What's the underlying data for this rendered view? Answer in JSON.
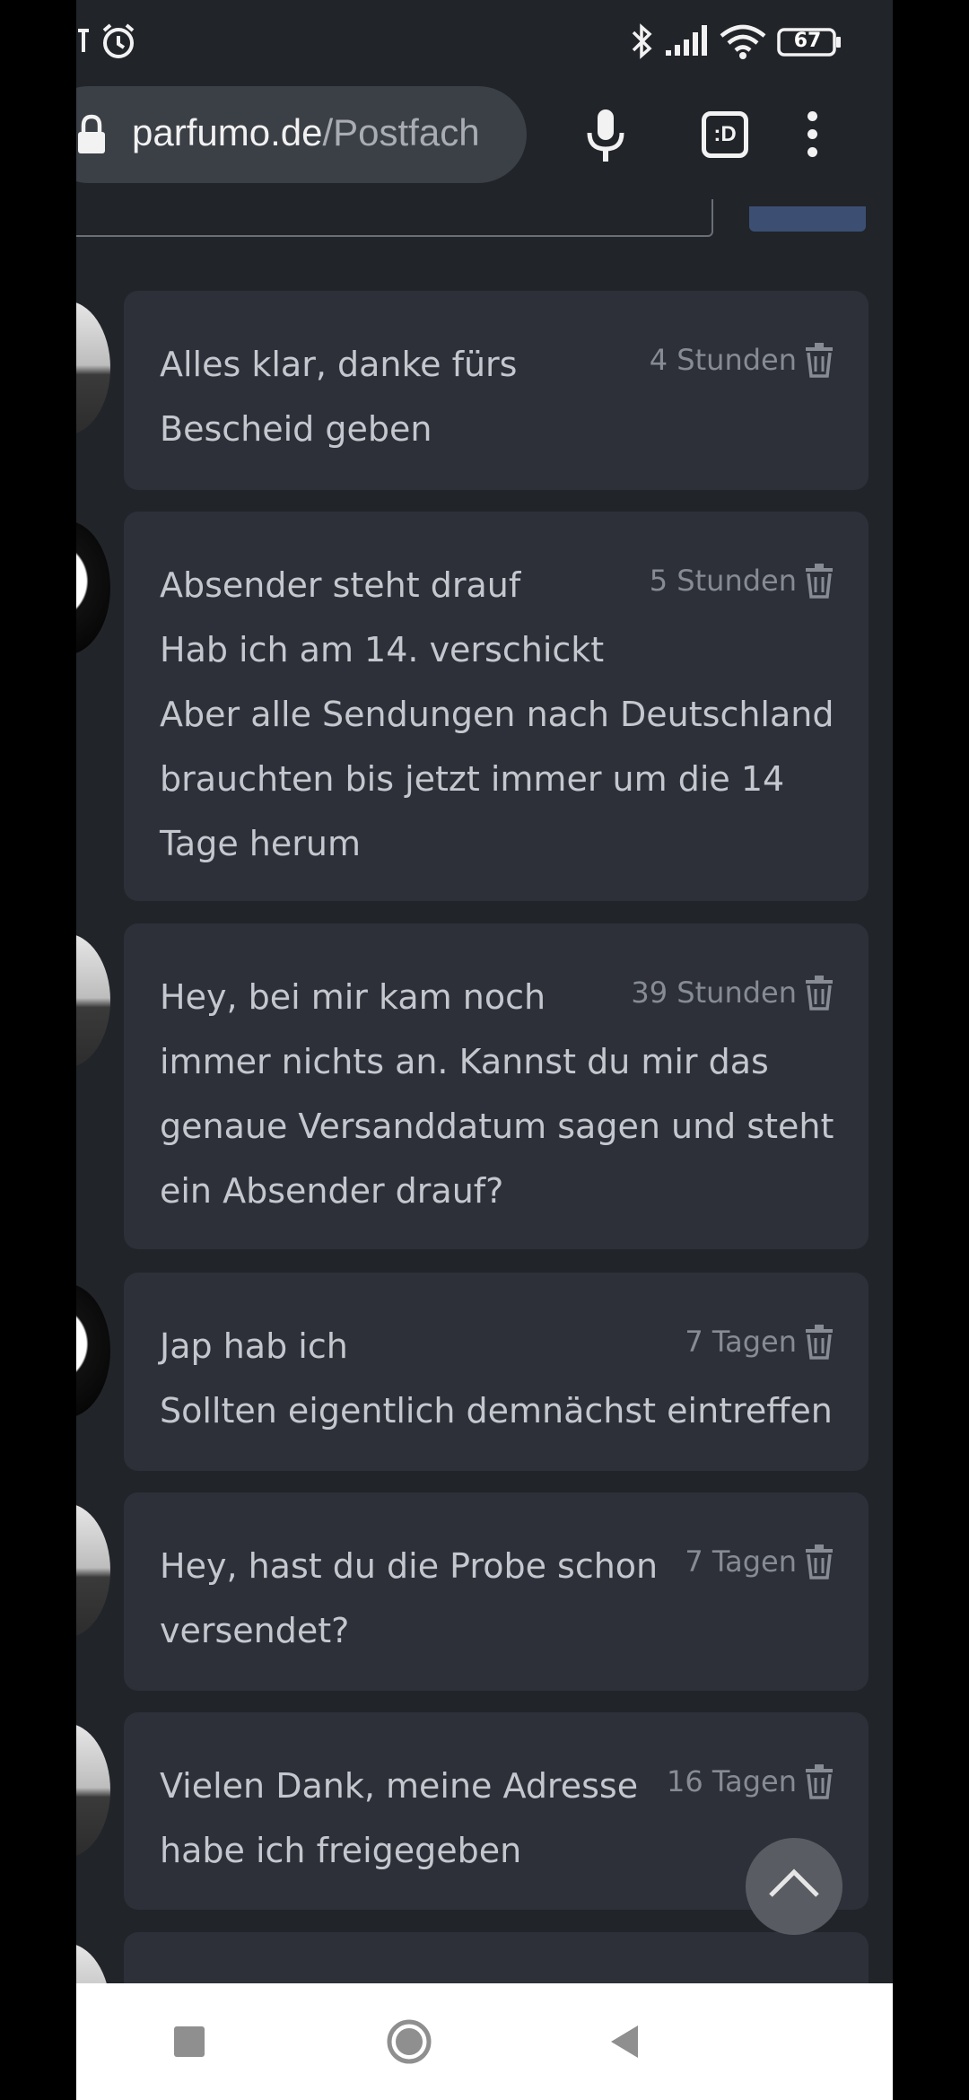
{
  "status_bar": {
    "battery": "67",
    "icons": [
      "alarm-icon",
      "bluetooth-icon",
      "signal-icon",
      "wifi-icon",
      "battery-icon"
    ]
  },
  "browser": {
    "url_host": "parfumo.de",
    "url_path": "/Postfach",
    "tab_icon_label": ":D",
    "icons": [
      "lock-icon",
      "microphone-icon",
      "tab-switcher-icon",
      "more-menu-icon"
    ]
  },
  "messages": [
    {
      "lines": [
        "Alles klar, danke fürs",
        "Bescheid geben"
      ],
      "time": "4 Stunden",
      "avatar": "grey"
    },
    {
      "lines": [
        "Absender steht drauf",
        "Hab ich am 14. verschickt",
        "Aber alle Sendungen nach Deutschland",
        "brauchten bis jetzt immer um die 14",
        "Tage herum"
      ],
      "time": "5 Stunden",
      "avatar": "dark"
    },
    {
      "lines": [
        "Hey, bei mir kam noch",
        "immer nichts an. Kannst du mir das",
        "genaue Versanddatum sagen und steht",
        "ein Absender drauf?"
      ],
      "time": "39 Stunden",
      "avatar": "grey"
    },
    {
      "lines": [
        "Jap hab ich",
        "Sollten eigentlich demnächst eintreffen"
      ],
      "time": "7 Tagen",
      "avatar": "dark"
    },
    {
      "lines": [
        "Hey, hast du die Probe schon",
        "versendet?"
      ],
      "time": "7 Tagen",
      "avatar": "grey"
    },
    {
      "lines": [
        "Vielen Dank, meine Adresse",
        "habe ich freigegeben"
      ],
      "time": "16 Tagen",
      "avatar": "grey"
    }
  ],
  "colors": {
    "page_bg": "#212429",
    "card_bg": "#2d3039",
    "text": "#c4c7cd",
    "meta": "#868b94"
  }
}
